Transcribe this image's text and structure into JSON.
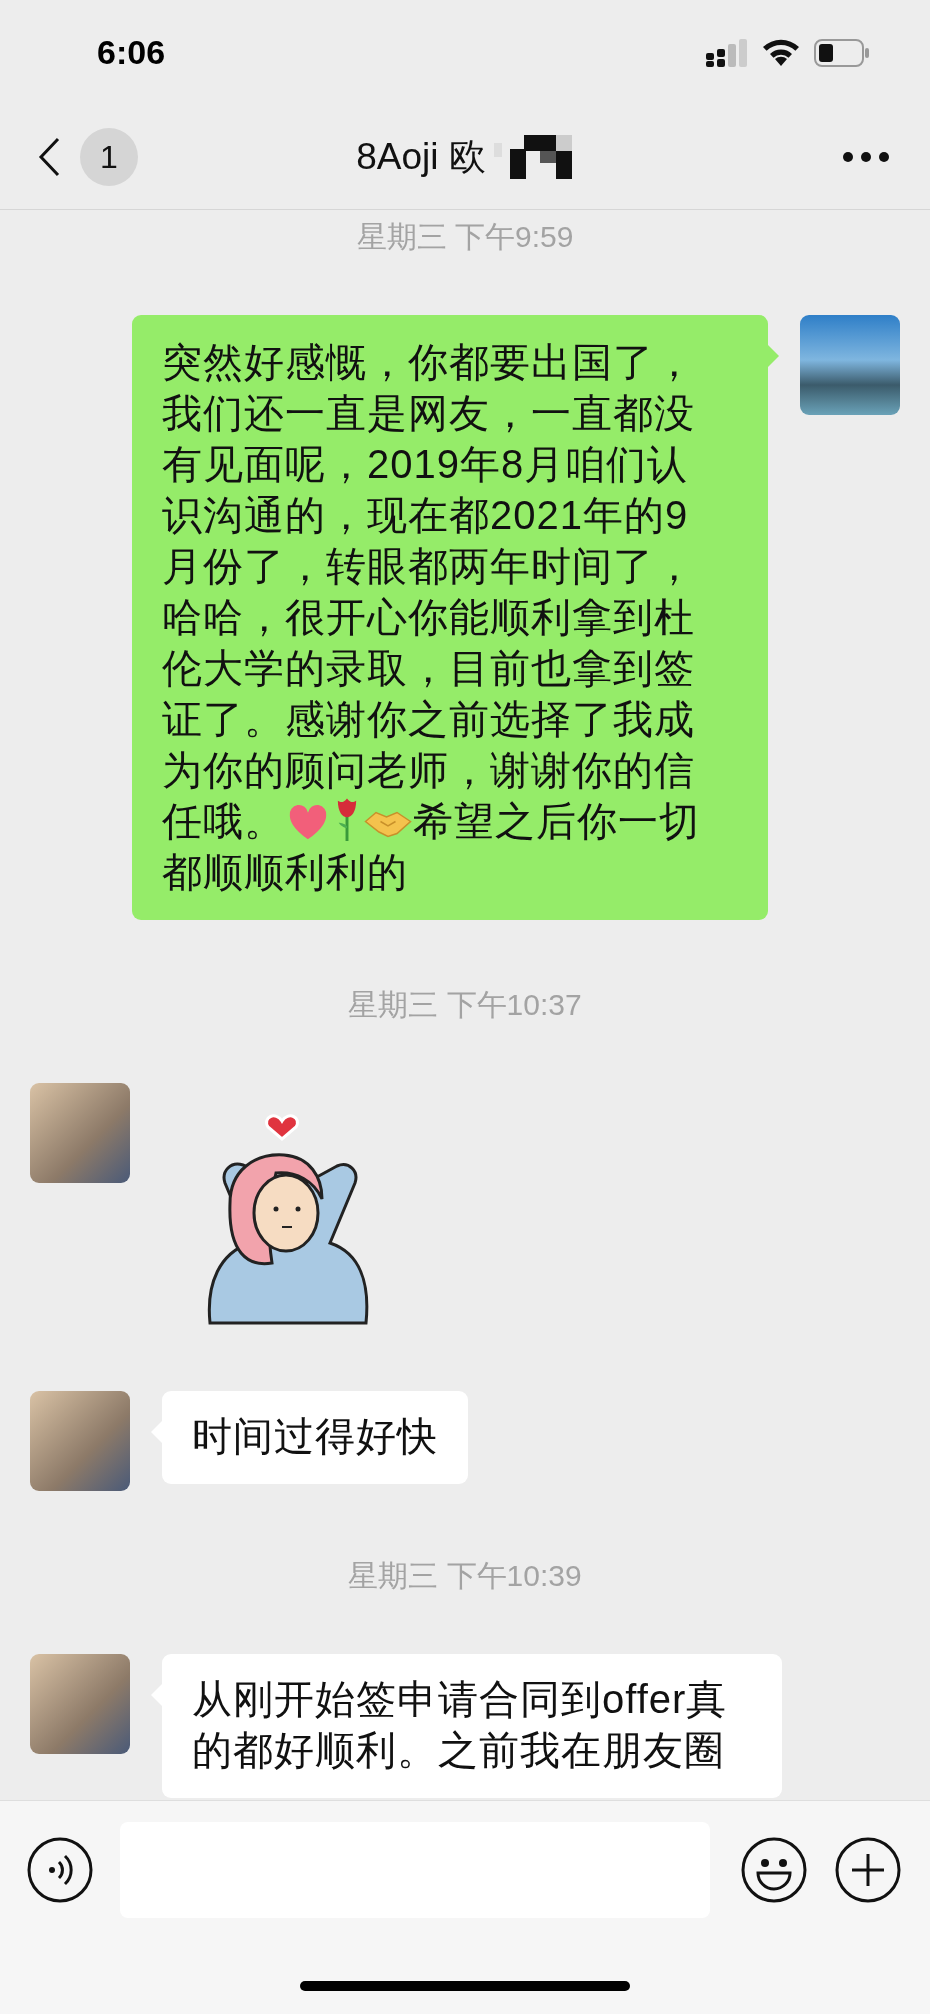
{
  "status_bar": {
    "time": "6:06"
  },
  "header": {
    "unread_count": "1",
    "title": "8Aoji 欧"
  },
  "messages": [
    {
      "kind": "timestamp",
      "text": "星期三 下午9:59"
    },
    {
      "kind": "sent",
      "lines": [
        [
          {
            "kind": "text",
            "text": "突然好感慨，你都要出国了，我们还一直是网友，一直都没有见面呢，2019年8月咱们认识沟通的，现在都2021年的9月份了，转眼都两年时间了，哈哈，很开心你能顺利拿到杜伦大学的录取，目前也拿到签证了。感谢你之前选择了我成为你的顾问老师，谢谢你的信"
          }
        ],
        [
          {
            "kind": "text",
            "text": "任哦。"
          },
          {
            "kind": "heart"
          },
          {
            "kind": "rose"
          },
          {
            "kind": "handshake"
          },
          {
            "kind": "text",
            "text": "希望之后你一切"
          }
        ],
        [
          {
            "kind": "text",
            "text": "都顺顺利利的"
          }
        ]
      ]
    },
    {
      "kind": "timestamp",
      "text": "星期三 下午10:37"
    },
    {
      "kind": "sticker"
    },
    {
      "kind": "received",
      "lines": [
        [
          {
            "kind": "text",
            "text": "时间过得好快"
          }
        ]
      ]
    },
    {
      "kind": "timestamp",
      "text": "星期三 下午10:39"
    },
    {
      "kind": "received",
      "lines": [
        [
          {
            "kind": "text",
            "text": "从刚开始签申请合同到offer真的都好顺利。之前我在朋友圈"
          }
        ]
      ]
    }
  ]
}
